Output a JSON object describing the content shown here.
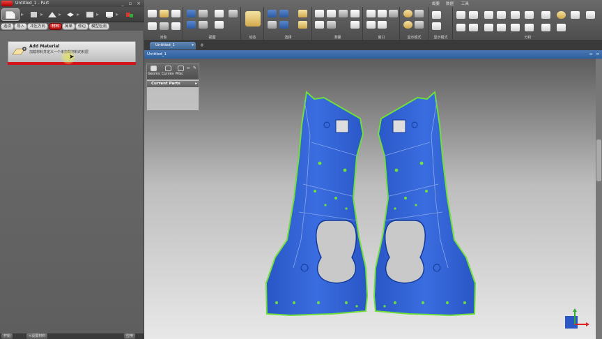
{
  "window": {
    "title": "Untitled_1 - Part"
  },
  "workflow": {
    "steps": [
      "file-icon",
      "import-icon",
      "flatten-icon",
      "blank-icon",
      "nest-icon",
      "report-icon",
      "export-icon"
    ]
  },
  "subtabs": [
    "选项",
    "导入",
    "冲压方向",
    "材料",
    "简单",
    "修边",
    "模型检测"
  ],
  "active_subtab_index": 3,
  "add_material": {
    "title": "Add Material",
    "description": "加载材料并定义一个未加载材料的料层"
  },
  "status_bar": {
    "left_label": "开始",
    "middle_label": "<设置材料",
    "right_label": "应用"
  },
  "ribbon": {
    "tab_labels": [
      "概要",
      "数据",
      "工具"
    ],
    "groups": [
      "对象",
      "视图",
      "动态",
      "选择",
      "测量",
      "窗口",
      "显示模式",
      "显示模式",
      "分析"
    ]
  },
  "doc_tab": {
    "label": "Untitled_1"
  },
  "viewport": {
    "header_title": "Untitled_1"
  },
  "parts_panel": {
    "tabs": [
      "Geoms",
      "Curves",
      "Misc"
    ],
    "section_title": "Current Parts"
  },
  "colors": {
    "part_blue": "#2f5fd0",
    "edge_green": "#6fe03a",
    "accent_red": "#d4141c",
    "viewport_header": "#3a6bb0"
  }
}
